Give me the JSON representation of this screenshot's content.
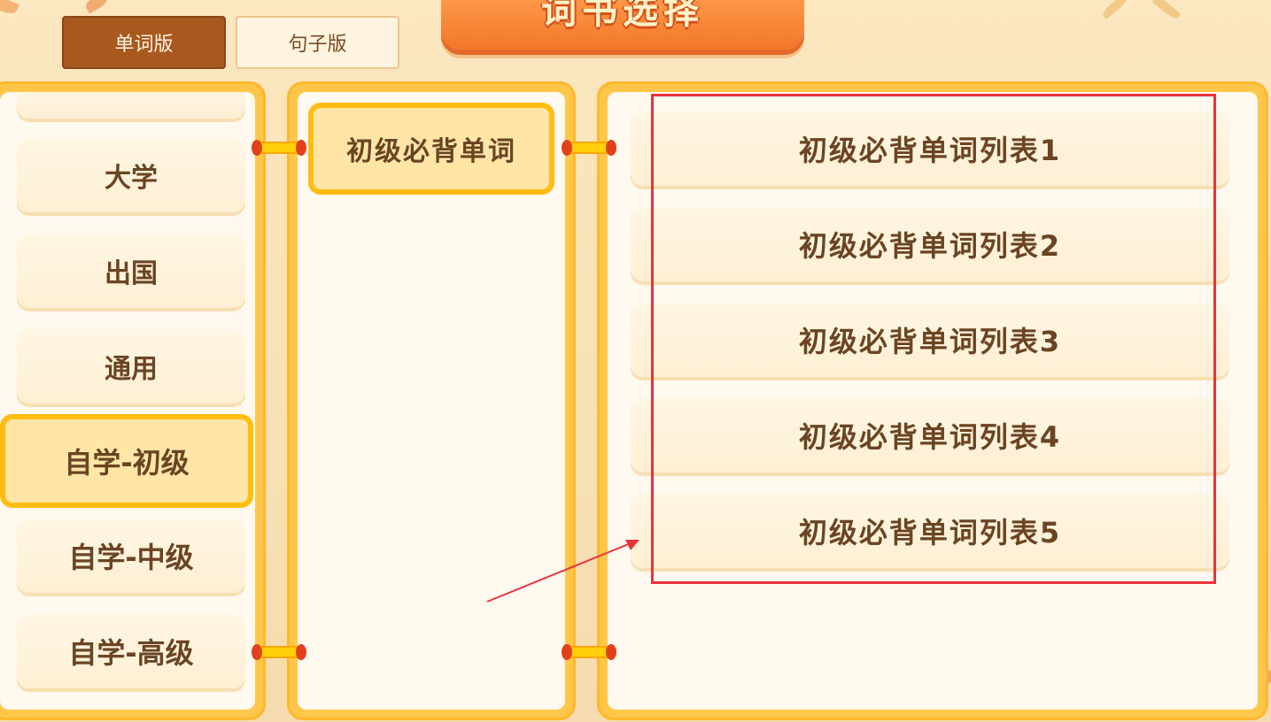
{
  "header": {
    "title": "词书选择",
    "tabs": [
      {
        "label": "单词版",
        "active": true
      },
      {
        "label": "句子版",
        "active": false
      }
    ]
  },
  "categories": {
    "items": [
      {
        "label": "大学"
      },
      {
        "label": "出国"
      },
      {
        "label": "通用"
      },
      {
        "label": "自学-初级",
        "selected": true
      },
      {
        "label": "自学-中级"
      },
      {
        "label": "自学-高级"
      }
    ]
  },
  "subcategories": {
    "items": [
      {
        "label": "初级必背单词",
        "selected": true
      }
    ]
  },
  "wordlists": {
    "items": [
      {
        "label": "初级必背单词列表1"
      },
      {
        "label": "初级必背单词列表2"
      },
      {
        "label": "初级必背单词列表3"
      },
      {
        "label": "初级必背单词列表4"
      },
      {
        "label": "初级必背单词列表5"
      }
    ]
  },
  "colors": {
    "accent_orange": "#f2772a",
    "selected_border": "#ffbd12",
    "annotation_red": "#e8333a",
    "text_brown": "#6a4423"
  }
}
